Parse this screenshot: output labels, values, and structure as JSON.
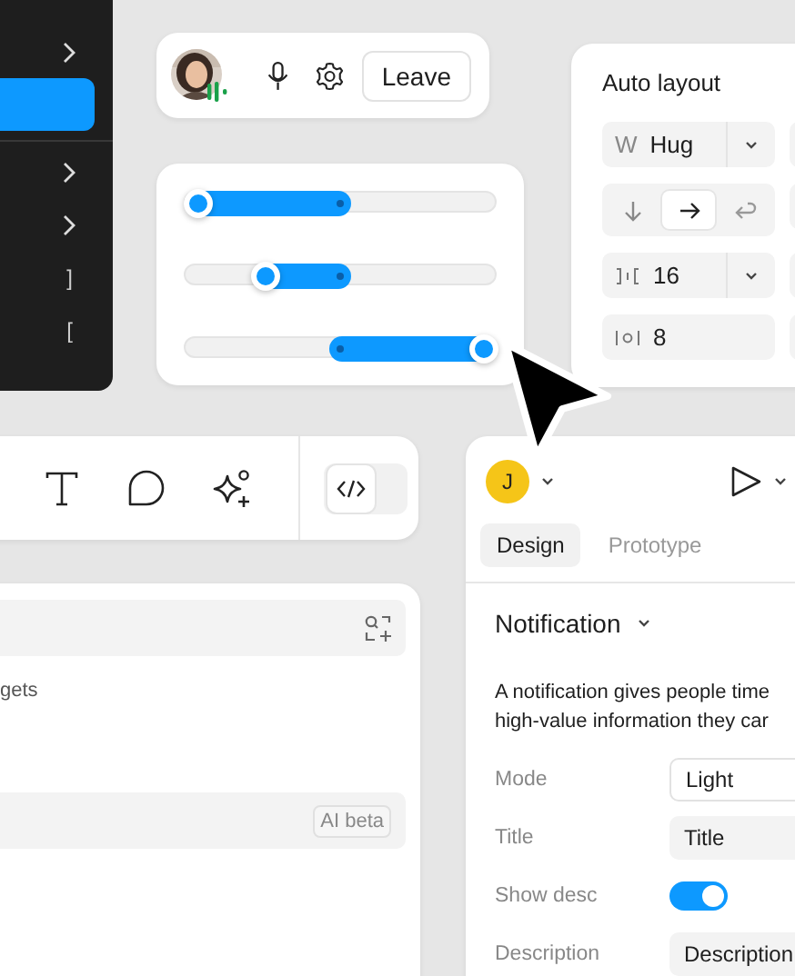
{
  "menu": {
    "items": [
      {
        "kind": "submenu",
        "selected": false
      },
      {
        "kind": "plain",
        "selected": true
      },
      {
        "kind": "submenu",
        "selected": false
      },
      {
        "kind": "submenu",
        "selected": false
      },
      {
        "kind": "shortcut",
        "selected": false,
        "shortcut": "]"
      },
      {
        "kind": "shortcut",
        "selected": false,
        "shortcut": "["
      }
    ]
  },
  "call": {
    "speaking": true,
    "button": "Leave"
  },
  "sliders": [
    {
      "level": 0.04
    },
    {
      "level": 0.26
    },
    {
      "level": 0.965
    }
  ],
  "auto_layout": {
    "title": "Auto layout",
    "width": {
      "prefix": "W",
      "value": "Hug"
    },
    "direction": [
      {
        "kind": "down",
        "selected": false
      },
      {
        "kind": "right",
        "selected": true
      },
      {
        "kind": "wrap",
        "selected": false
      }
    ],
    "gap": {
      "value": "16"
    },
    "padding": {
      "value": "8"
    }
  },
  "toolbar": {
    "tools": [
      {
        "kind": "text"
      },
      {
        "kind": "comment"
      },
      {
        "kind": "ai"
      }
    ],
    "code_mode": true
  },
  "assets": {
    "partial_text": "gets",
    "badge": "AI beta"
  },
  "inspector": {
    "avatar": "J",
    "tabs": [
      {
        "label": "Design",
        "selected": true
      },
      {
        "label": "Prototype",
        "selected": false
      }
    ],
    "component": "Notification",
    "description": [
      "A notification gives people time",
      "high-value information they car"
    ],
    "props": [
      {
        "kind": "select",
        "label": "Mode",
        "value": "Light"
      },
      {
        "kind": "input",
        "label": "Title",
        "value": "Title"
      },
      {
        "kind": "toggle",
        "label": "Show desc",
        "on": true
      },
      {
        "kind": "input",
        "label": "Description",
        "value": "Description"
      }
    ]
  }
}
